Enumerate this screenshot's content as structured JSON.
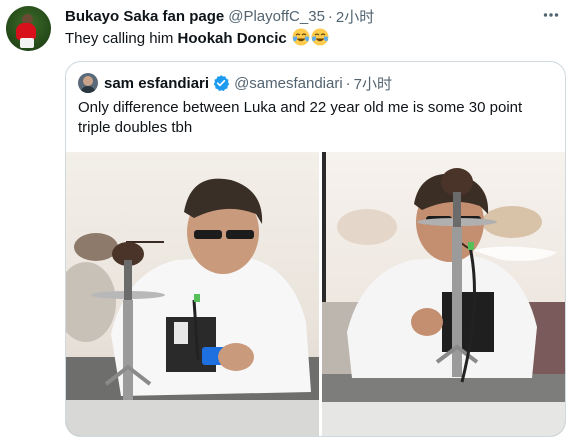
{
  "tweet": {
    "author_name": "Bukayo Saka fan page",
    "author_handle": "@PlayoffC_35",
    "separator": "·",
    "time": "2小时",
    "text_prefix": "They calling him ",
    "text_bold": "Hookah Doncic",
    "emojis": [
      "face-with-tears-of-joy-icon",
      "face-with-tears-of-joy-icon"
    ],
    "avatar_icon": "soccer-player-avatar"
  },
  "quoted_tweet": {
    "author_name": "sam esfandiari",
    "verified_icon": "verified-badge-icon",
    "author_handle": "@samesfandiari",
    "separator": "·",
    "time": "7小时",
    "text": "Only difference between Luka and 22 year old me is some 30 point triple doubles tbh",
    "photos": [
      "photo-man-with-hookah-phone",
      "photo-man-with-hookah-smoke"
    ]
  },
  "colors": {
    "text_primary": "#0f1419",
    "text_secondary": "#536471",
    "border": "#cfd9de",
    "verified": "#1d9bf0"
  }
}
